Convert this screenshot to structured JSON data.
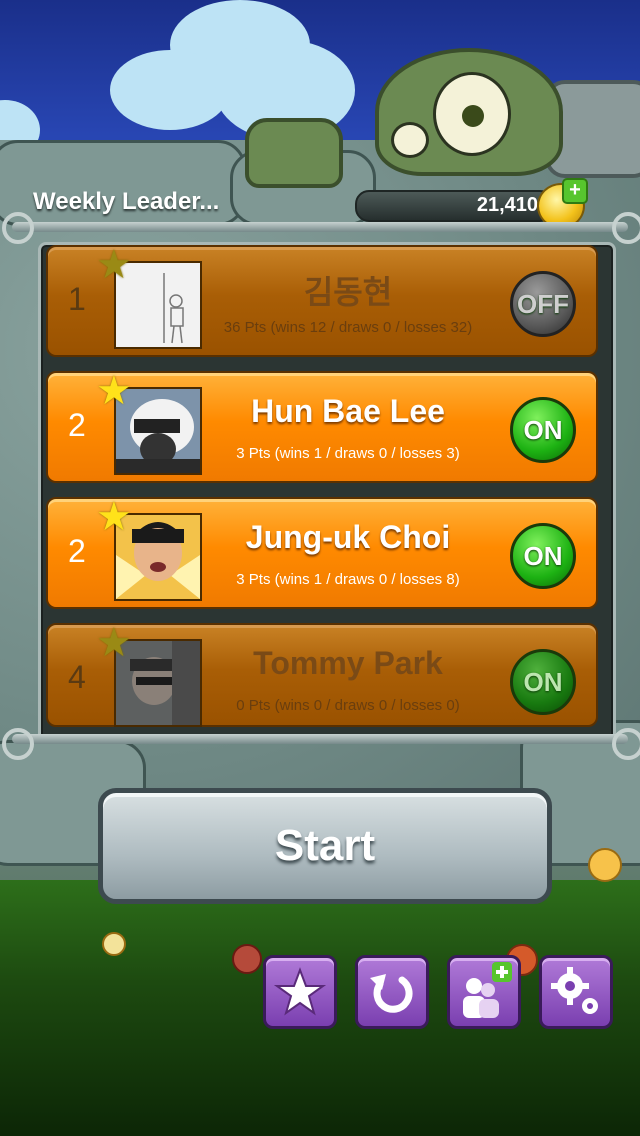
{
  "header": {
    "title": "Weekly Leader...",
    "coins": "21,410"
  },
  "leaderboard": [
    {
      "rank": "1",
      "name": "김동현",
      "stats": "36 Pts (wins 12 / draws 0 / losses 32)",
      "toggle": "OFF",
      "dim": true
    },
    {
      "rank": "2",
      "name": "Hun Bae Lee",
      "stats": "3 Pts (wins 1 / draws 0 / losses 3)",
      "toggle": "ON",
      "dim": false
    },
    {
      "rank": "2",
      "name": "Jung-uk Choi",
      "stats": "3 Pts (wins 1 / draws 0 / losses 8)",
      "toggle": "ON",
      "dim": false
    },
    {
      "rank": "4",
      "name": "Tommy Park",
      "stats": "0 Pts (wins 0 / draws 0 / losses 0)",
      "toggle": "ON",
      "dim": true
    }
  ],
  "start_button": {
    "label": "Start"
  },
  "toolbar": [
    {
      "icon": "star-icon"
    },
    {
      "icon": "refresh-icon"
    },
    {
      "icon": "add-friend-icon"
    },
    {
      "icon": "settings-icon"
    }
  ],
  "colors": {
    "row_active": "#ff8a00",
    "row_dim": "#a95e06",
    "toggle_on": "#1db213",
    "toggle_off": "#5a5a5a",
    "toolbar_button": "#7a3fb0"
  }
}
